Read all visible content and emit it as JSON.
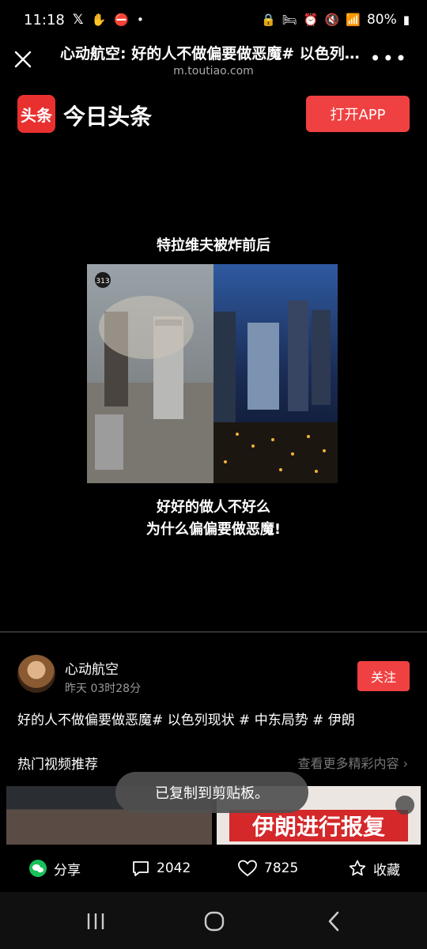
{
  "status_bar": {
    "time": "11:18",
    "battery": "80%"
  },
  "browser": {
    "title": "心动航空: 好的人不做偏要做恶魔# 以色列现状 # 中东局势 # 伊朗",
    "url": "m.toutiao.com"
  },
  "app_header": {
    "logo_mark": "头条",
    "app_name": "今日头条",
    "open_app_label": "打开APP",
    "brand_color": "#f04142"
  },
  "video": {
    "caption_top": "特拉维夫被炸前后",
    "caption_line1": "好好的做人不好么",
    "caption_line2": "为什么偏偏要做恶魔!",
    "frame_badge": "313"
  },
  "author": {
    "name": "心动航空",
    "time": "昨天 03时28分",
    "follow_label": "关注"
  },
  "description": "好的人不做偏要做恶魔# 以色列现状 # 中东局势 # 伊朗",
  "recommend": {
    "title": "热门视频推荐",
    "more_label": "查看更多精彩内容",
    "thumb2_banner": "伊朗进行报复"
  },
  "toast": "已复制到剪贴板。",
  "actions": {
    "share_label": "分享",
    "comments_count": "2042",
    "likes_count": "7825",
    "favorite_label": "收藏"
  }
}
